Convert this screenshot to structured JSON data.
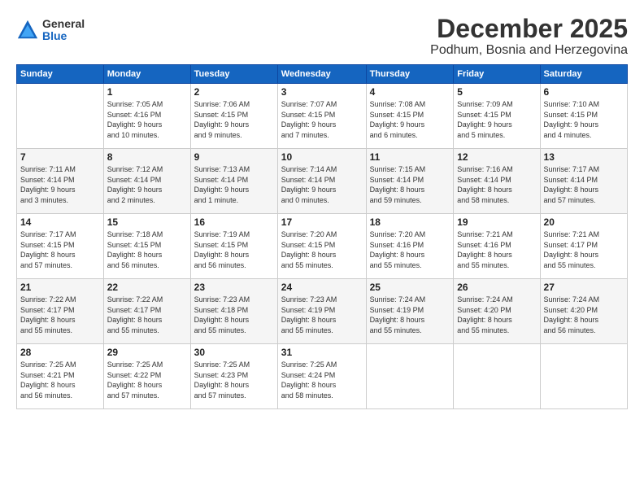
{
  "logo": {
    "general": "General",
    "blue": "Blue"
  },
  "header": {
    "title": "December 2025",
    "subtitle": "Podhum, Bosnia and Herzegovina"
  },
  "calendar": {
    "weekdays": [
      "Sunday",
      "Monday",
      "Tuesday",
      "Wednesday",
      "Thursday",
      "Friday",
      "Saturday"
    ],
    "weeks": [
      [
        {
          "day": "",
          "info": ""
        },
        {
          "day": "1",
          "info": "Sunrise: 7:05 AM\nSunset: 4:16 PM\nDaylight: 9 hours\nand 10 minutes."
        },
        {
          "day": "2",
          "info": "Sunrise: 7:06 AM\nSunset: 4:15 PM\nDaylight: 9 hours\nand 9 minutes."
        },
        {
          "day": "3",
          "info": "Sunrise: 7:07 AM\nSunset: 4:15 PM\nDaylight: 9 hours\nand 7 minutes."
        },
        {
          "day": "4",
          "info": "Sunrise: 7:08 AM\nSunset: 4:15 PM\nDaylight: 9 hours\nand 6 minutes."
        },
        {
          "day": "5",
          "info": "Sunrise: 7:09 AM\nSunset: 4:15 PM\nDaylight: 9 hours\nand 5 minutes."
        },
        {
          "day": "6",
          "info": "Sunrise: 7:10 AM\nSunset: 4:15 PM\nDaylight: 9 hours\nand 4 minutes."
        }
      ],
      [
        {
          "day": "7",
          "info": "Sunrise: 7:11 AM\nSunset: 4:14 PM\nDaylight: 9 hours\nand 3 minutes."
        },
        {
          "day": "8",
          "info": "Sunrise: 7:12 AM\nSunset: 4:14 PM\nDaylight: 9 hours\nand 2 minutes."
        },
        {
          "day": "9",
          "info": "Sunrise: 7:13 AM\nSunset: 4:14 PM\nDaylight: 9 hours\nand 1 minute."
        },
        {
          "day": "10",
          "info": "Sunrise: 7:14 AM\nSunset: 4:14 PM\nDaylight: 9 hours\nand 0 minutes."
        },
        {
          "day": "11",
          "info": "Sunrise: 7:15 AM\nSunset: 4:14 PM\nDaylight: 8 hours\nand 59 minutes."
        },
        {
          "day": "12",
          "info": "Sunrise: 7:16 AM\nSunset: 4:14 PM\nDaylight: 8 hours\nand 58 minutes."
        },
        {
          "day": "13",
          "info": "Sunrise: 7:17 AM\nSunset: 4:14 PM\nDaylight: 8 hours\nand 57 minutes."
        }
      ],
      [
        {
          "day": "14",
          "info": "Sunrise: 7:17 AM\nSunset: 4:15 PM\nDaylight: 8 hours\nand 57 minutes."
        },
        {
          "day": "15",
          "info": "Sunrise: 7:18 AM\nSunset: 4:15 PM\nDaylight: 8 hours\nand 56 minutes."
        },
        {
          "day": "16",
          "info": "Sunrise: 7:19 AM\nSunset: 4:15 PM\nDaylight: 8 hours\nand 56 minutes."
        },
        {
          "day": "17",
          "info": "Sunrise: 7:20 AM\nSunset: 4:15 PM\nDaylight: 8 hours\nand 55 minutes."
        },
        {
          "day": "18",
          "info": "Sunrise: 7:20 AM\nSunset: 4:16 PM\nDaylight: 8 hours\nand 55 minutes."
        },
        {
          "day": "19",
          "info": "Sunrise: 7:21 AM\nSunset: 4:16 PM\nDaylight: 8 hours\nand 55 minutes."
        },
        {
          "day": "20",
          "info": "Sunrise: 7:21 AM\nSunset: 4:17 PM\nDaylight: 8 hours\nand 55 minutes."
        }
      ],
      [
        {
          "day": "21",
          "info": "Sunrise: 7:22 AM\nSunset: 4:17 PM\nDaylight: 8 hours\nand 55 minutes."
        },
        {
          "day": "22",
          "info": "Sunrise: 7:22 AM\nSunset: 4:17 PM\nDaylight: 8 hours\nand 55 minutes."
        },
        {
          "day": "23",
          "info": "Sunrise: 7:23 AM\nSunset: 4:18 PM\nDaylight: 8 hours\nand 55 minutes."
        },
        {
          "day": "24",
          "info": "Sunrise: 7:23 AM\nSunset: 4:19 PM\nDaylight: 8 hours\nand 55 minutes."
        },
        {
          "day": "25",
          "info": "Sunrise: 7:24 AM\nSunset: 4:19 PM\nDaylight: 8 hours\nand 55 minutes."
        },
        {
          "day": "26",
          "info": "Sunrise: 7:24 AM\nSunset: 4:20 PM\nDaylight: 8 hours\nand 55 minutes."
        },
        {
          "day": "27",
          "info": "Sunrise: 7:24 AM\nSunset: 4:20 PM\nDaylight: 8 hours\nand 56 minutes."
        }
      ],
      [
        {
          "day": "28",
          "info": "Sunrise: 7:25 AM\nSunset: 4:21 PM\nDaylight: 8 hours\nand 56 minutes."
        },
        {
          "day": "29",
          "info": "Sunrise: 7:25 AM\nSunset: 4:22 PM\nDaylight: 8 hours\nand 57 minutes."
        },
        {
          "day": "30",
          "info": "Sunrise: 7:25 AM\nSunset: 4:23 PM\nDaylight: 8 hours\nand 57 minutes."
        },
        {
          "day": "31",
          "info": "Sunrise: 7:25 AM\nSunset: 4:24 PM\nDaylight: 8 hours\nand 58 minutes."
        },
        {
          "day": "",
          "info": ""
        },
        {
          "day": "",
          "info": ""
        },
        {
          "day": "",
          "info": ""
        }
      ]
    ]
  }
}
